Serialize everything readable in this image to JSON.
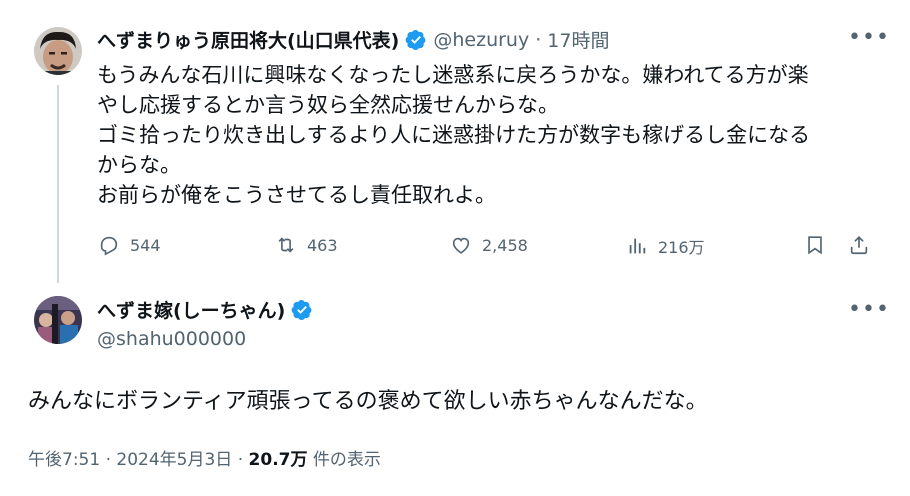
{
  "tweet1": {
    "author_name": "へずまりゅう原田将大(山口県代表)",
    "handle": "@hezuruy",
    "separator": "·",
    "time": "17時間",
    "lines": [
      "もうみんな石川に興味なくなったし迷惑系に戻ろうかな。嫌われてる方が楽",
      "やし応援するとか言う奴ら全然応援せんからな。",
      "ゴミ拾ったり炊き出しするより人に迷惑掛けた方が数字も稼げるし金になる",
      "からな。",
      "お前らが俺をこうさせてるし責任取れよ。"
    ],
    "actions": {
      "replies": "544",
      "retweets": "463",
      "likes": "2,458",
      "views": "216万"
    }
  },
  "tweet2": {
    "author_name": "へずま嫁(しーちゃん)",
    "handle": "@shahu000000",
    "text": "みんなにボランティア頑張ってるの褒めて欲しい赤ちゃんなんだな。",
    "time": "午後7:51",
    "sep1": "·",
    "date": "2024年5月3日",
    "sep2": "·",
    "view_count": "20.7万",
    "view_label": "件の表示"
  },
  "colors": {
    "verified_blue": "#1d9bf0",
    "secondary_text": "#536471",
    "thread_line": "#cfd9de"
  },
  "icons": [
    "more-icon",
    "verified-badge-icon",
    "reply-icon",
    "retweet-icon",
    "like-icon",
    "views-icon",
    "bookmark-icon",
    "share-icon"
  ]
}
